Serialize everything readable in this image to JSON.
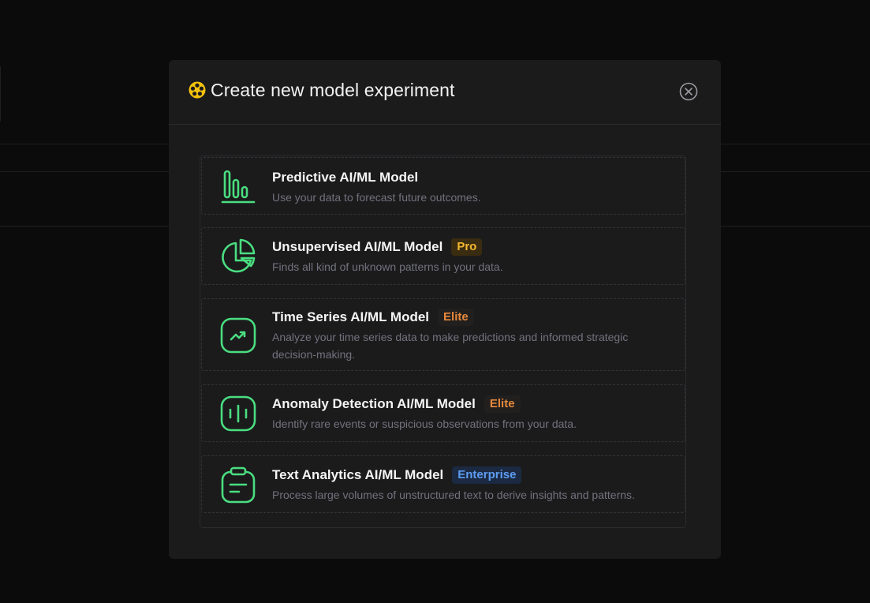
{
  "modal": {
    "title": "Create new model experiment",
    "logo_icon": "flower-logo-icon",
    "close_icon": "close-circle-icon"
  },
  "colors": {
    "accent_green": "#4ade80",
    "logo_yellow": "#f4c20d",
    "pro": "#f4b731",
    "elite": "#e7883a",
    "enterprise": "#5e9cf2"
  },
  "options": [
    {
      "title": "Predictive AI/ML Model",
      "badge": "",
      "description": "Use your data to forecast future outcomes.",
      "icon": "bar-chart-icon"
    },
    {
      "title": "Unsupervised AI/ML Model",
      "badge": "Pro",
      "description": "Finds all kind of unknown patterns in your data.",
      "icon": "pie-chart-icon"
    },
    {
      "title": "Time Series AI/ML Model",
      "badge": "Elite",
      "description": "Analyze your time series data to make predictions and informed strategic decision-making.",
      "icon": "trending-up-icon"
    },
    {
      "title": "Anomaly Detection AI/ML Model",
      "badge": "Elite",
      "description": "Identify rare events or suspicious observations from your data.",
      "icon": "anomaly-icon"
    },
    {
      "title": "Text Analytics AI/ML Model",
      "badge": "Enterprise",
      "description": "Process large volumes of unstructured text to derive insights and patterns.",
      "icon": "clipboard-text-icon"
    }
  ]
}
